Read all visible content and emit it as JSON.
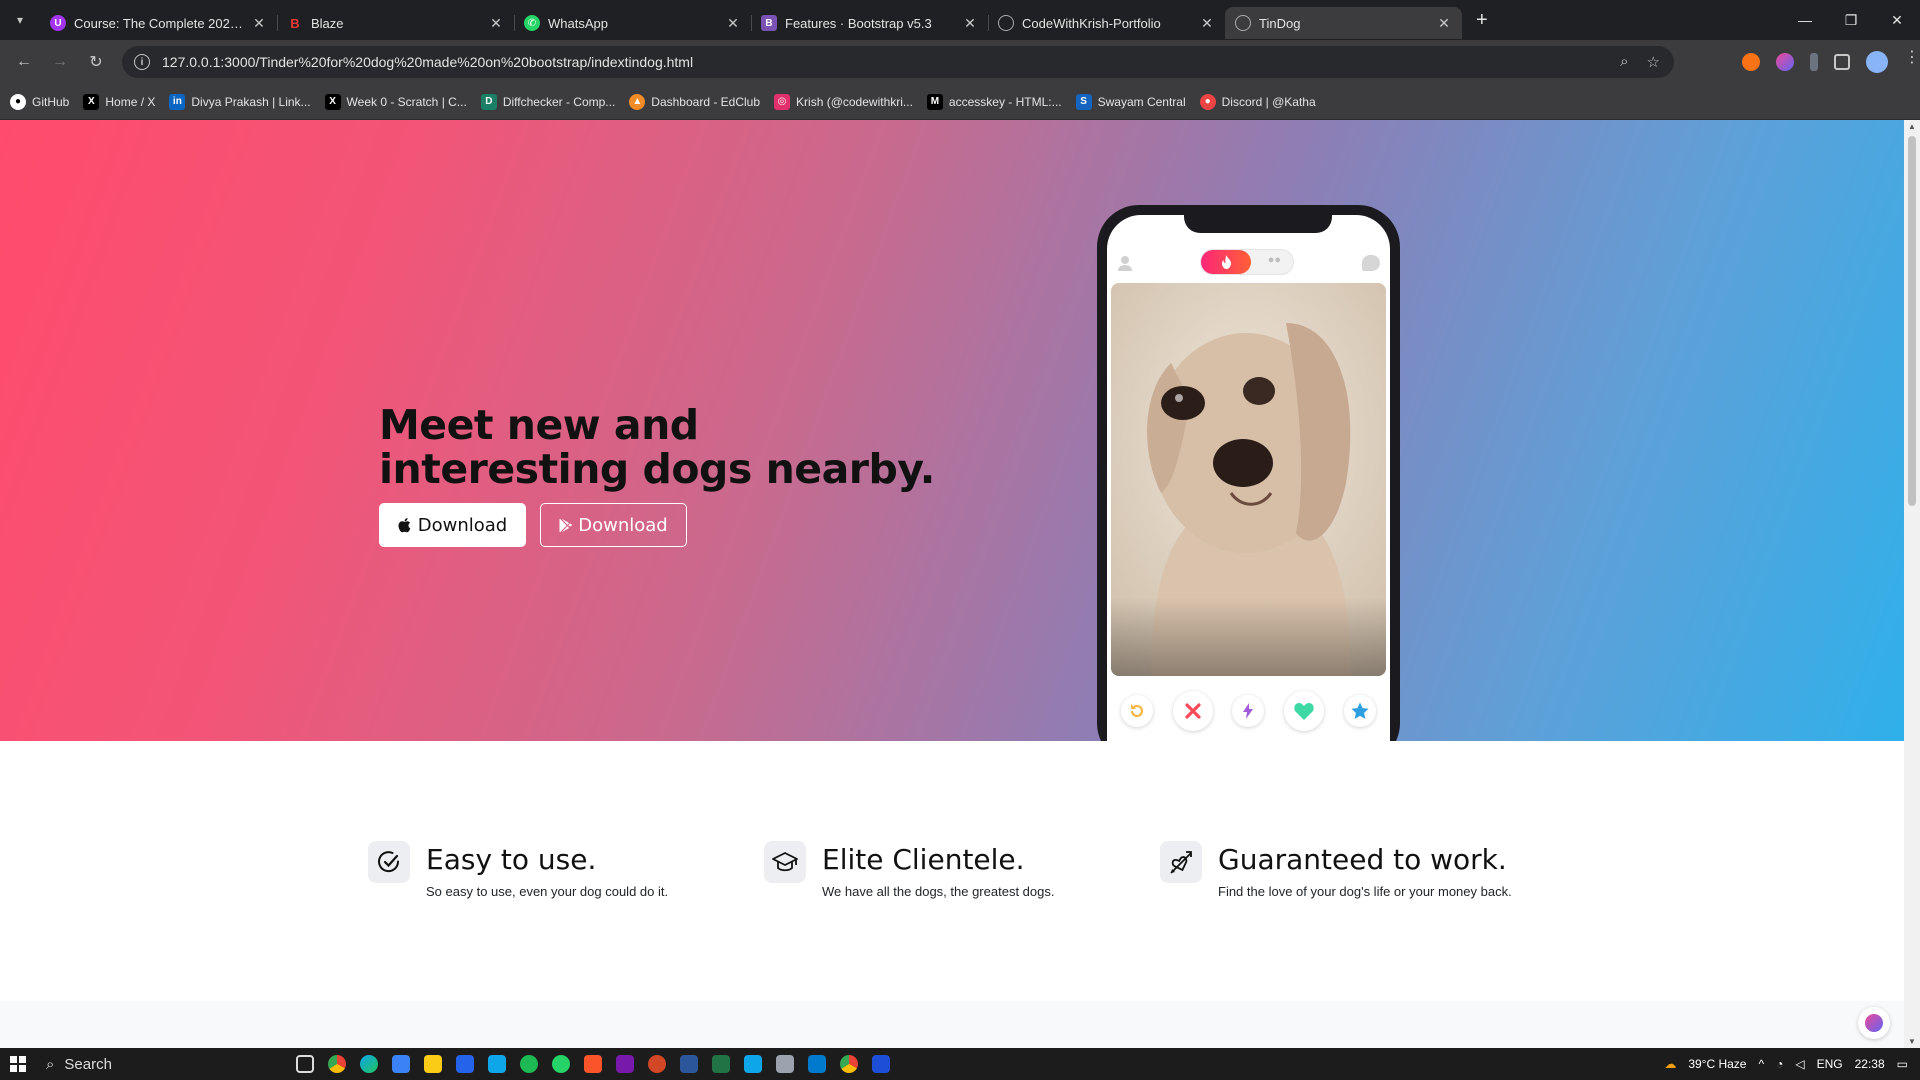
{
  "browser": {
    "tabs": [
      {
        "title": "Course: The Complete 2024 Web",
        "color": "#a435f0",
        "letter": "U"
      },
      {
        "title": "Blaze",
        "color": "#e53935",
        "letter": "B"
      },
      {
        "title": "WhatsApp",
        "color": "#25d366",
        "letter": "W"
      },
      {
        "title": "Features · Bootstrap v5.3",
        "color": "#7952b3",
        "letter": "B"
      },
      {
        "title": "CodeWithKrish-Portfolio",
        "color": "#888888",
        "letter": ""
      },
      {
        "title": "TinDog",
        "color": "#888888",
        "letter": ""
      }
    ],
    "url": "127.0.0.1:3000/Tinder%20for%20dog%20made%20on%20bootstrap/indextindog.html",
    "bookmarks": [
      {
        "label": "GitHub",
        "color": "#ffffff"
      },
      {
        "label": "Home / X",
        "color": "#000000"
      },
      {
        "label": "Divya Prakash | Link...",
        "color": "#0a66c2"
      },
      {
        "label": "Week 0 - Scratch | C...",
        "color": "#000000"
      },
      {
        "label": "Diffchecker - Comp...",
        "color": "#1a7f64"
      },
      {
        "label": "Dashboard - EdClub",
        "color": "#f28c28"
      },
      {
        "label": "Krish (@codewithkri...",
        "color": "#e1306c"
      },
      {
        "label": "accesskey - HTML:...",
        "color": "#000000"
      },
      {
        "label": "Swayam Central",
        "color": "#1565c0"
      },
      {
        "label": "Discord | @Katha",
        "color": "#ef4444"
      }
    ]
  },
  "hero": {
    "headline": "Meet new and interesting dogs nearby.",
    "download_apple": "Download",
    "download_play": "Download"
  },
  "features": [
    {
      "title": "Easy to use.",
      "text": "So easy to use, even your dog could do it.",
      "icon": "check-circle-icon"
    },
    {
      "title": "Elite Clientele.",
      "text": "We have all the dogs, the greatest dogs.",
      "icon": "graduation-cap-icon"
    },
    {
      "title": "Guaranteed to work.",
      "text": "Find the love of your dog's life or your money back.",
      "icon": "heart-arrow-icon"
    }
  ],
  "taskbar": {
    "search": "Search",
    "weather": "39°C  Haze",
    "lang": "ENG",
    "time": "22:38"
  },
  "colors": {
    "hero_start": "#ff4b6c",
    "hero_end": "#2fb0ea",
    "tinder_gradient_start": "#fd267a",
    "tinder_gradient_end": "#ff6036"
  }
}
